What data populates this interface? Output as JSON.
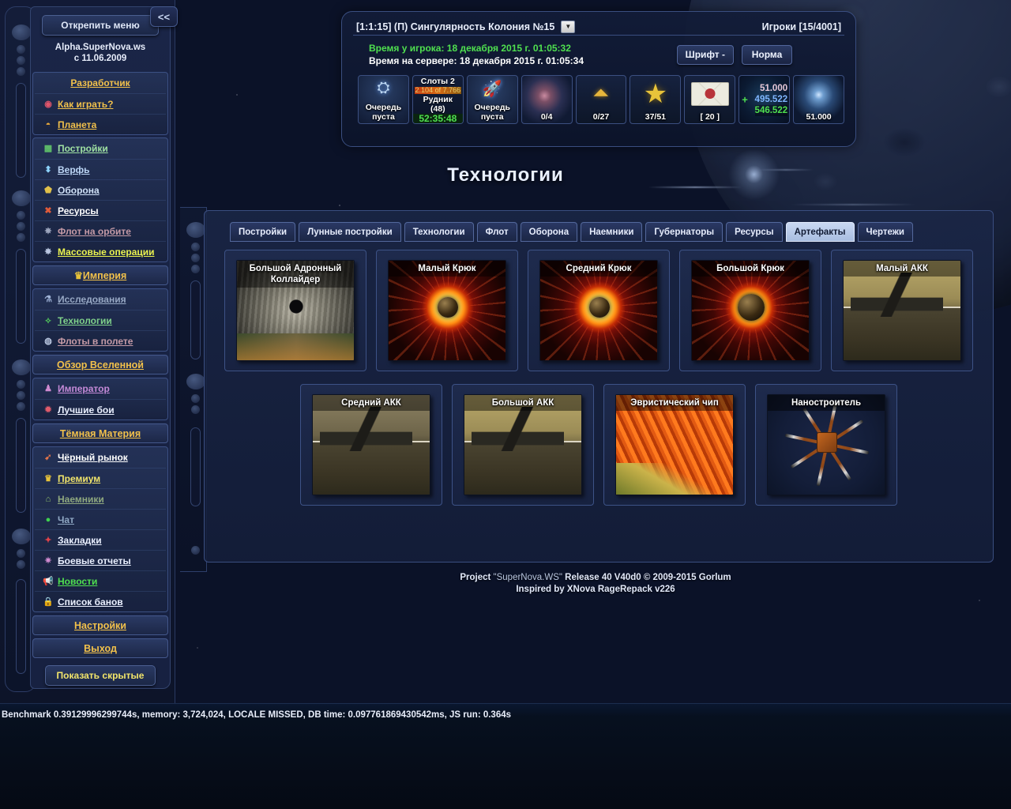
{
  "sidebar": {
    "collapse_label": "<<",
    "unpin_label": "Открепить меню",
    "site_line1": "Alpha.SuperNova.ws",
    "site_line2": "с 11.06.2009",
    "show_hidden_label": "Показать скрытые",
    "links": [
      {
        "label": "Разработчик",
        "icon": "",
        "color": "#f2c14b",
        "group": "a"
      },
      {
        "label": "Как играть?",
        "icon": "circle-red-icon",
        "glyph": "◉",
        "icon_color": "#e0556b",
        "color": "#f2c14b",
        "group": "a"
      },
      {
        "label": "Планета",
        "icon": "planet-icon",
        "glyph": "◓",
        "icon_color": "#e8a93c",
        "color": "#f2c14b",
        "group": "a"
      }
    ],
    "groups": [
      {
        "name": "buildings-group",
        "items": [
          {
            "label": "Постройки",
            "icon": "factory-icon",
            "glyph": "▩",
            "icon_color": "#5fc06a",
            "color": "#9fe0a2"
          },
          {
            "label": "Верфь",
            "icon": "shipyard-icon",
            "glyph": "⬍",
            "icon_color": "#8fd6ff",
            "color": "#bcd6f6"
          },
          {
            "label": "Оборона",
            "icon": "shield-icon",
            "glyph": "⬟",
            "icon_color": "#e0c04a",
            "color": "#cfe0f6"
          },
          {
            "label": "Ресурсы",
            "icon": "resources-icon",
            "glyph": "✖",
            "icon_color": "#e05b3a",
            "color": "#ffffff"
          },
          {
            "label": "Флот на орбите",
            "icon": "fleet-orbit-icon",
            "glyph": "✵",
            "icon_color": "#9fa8c0",
            "color": "#c49aa6"
          },
          {
            "label": "Массовые операции",
            "icon": "mass-ops-icon",
            "glyph": "✸",
            "icon_color": "#b9c6e0",
            "color": "#eaf24f"
          }
        ]
      }
    ],
    "empire_label": "Империя",
    "empire_icon": "crown-icon",
    "research_group": [
      {
        "label": "Исследования",
        "icon": "flask-icon",
        "glyph": "⚗",
        "icon_color": "#9fb3d6",
        "color": "#97a8c4"
      },
      {
        "label": "Технологии",
        "icon": "tech-icon",
        "glyph": "⟡",
        "icon_color": "#4fbf5a",
        "color": "#7fd18a"
      },
      {
        "label": "Флоты в полете",
        "icon": "fleets-flight-icon",
        "glyph": "◍",
        "icon_color": "#b9c6e0",
        "color": "#c49aa6"
      }
    ],
    "universe_label": "Обзор Вселенной",
    "emperor_group": [
      {
        "label": "Император",
        "icon": "emperor-icon",
        "glyph": "♟",
        "icon_color": "#d08ad0",
        "color": "#c58ad8"
      },
      {
        "label": "Лучшие бои",
        "icon": "best-battles-icon",
        "glyph": "✹",
        "icon_color": "#e05b6b",
        "color": "#eaf0ff"
      }
    ],
    "dark_matter_label": "Тёмная Материя",
    "market_group": [
      {
        "label": "Чёрный рынок",
        "icon": "market-icon",
        "glyph": "➹",
        "icon_color": "#e0734a",
        "color": "#ffffff"
      },
      {
        "label": "Премиум",
        "icon": "premium-crown-icon",
        "glyph": "♛",
        "icon_color": "#e8c33a",
        "color": "#f2e56b"
      },
      {
        "label": "Наемники",
        "icon": "mercenary-icon",
        "glyph": "⌂",
        "icon_color": "#8fbf6a",
        "color": "#8fa87f"
      },
      {
        "label": "Чат",
        "icon": "chat-icon",
        "glyph": "●",
        "icon_color": "#3fd14f",
        "color": "#8fa8c4"
      },
      {
        "label": "Закладки",
        "icon": "bookmark-icon",
        "glyph": "✦",
        "icon_color": "#e0434a",
        "color": "#eaf0ff"
      },
      {
        "label": "Боевые отчеты",
        "icon": "battle-reports-icon",
        "glyph": "✷",
        "icon_color": "#d08ad0",
        "color": "#eaf0ff"
      },
      {
        "label": "Новости",
        "icon": "news-icon",
        "glyph": "📢",
        "icon_color": "#e05b3a",
        "color": "#4fe04f"
      },
      {
        "label": "Список банов",
        "icon": "ban-list-icon",
        "glyph": "🔒",
        "icon_color": "#d6c46a",
        "color": "#eaf0ff"
      }
    ],
    "settings_label": "Настройки",
    "exit_label": "Выход"
  },
  "top_panel": {
    "planet_label": "[1:1:15] (П) Сингулярность Колония №15",
    "planet_caret": "▼",
    "players_label": "Игроки [15/4001]",
    "time_player": "Время у игрока: 18 декабря 2015 г. 01:05:32",
    "time_server": "Время на сервере: 18 декабря 2015 г. 01:05:34",
    "btn_font": "Шрифт -",
    "btn_norm": "Норма",
    "tiles": [
      {
        "name": "building-queue-tile",
        "type": "queue",
        "line1": "Очередь",
        "line2": "пуста"
      },
      {
        "name": "mine-slots-tile",
        "type": "slots",
        "title": "Слоты 2",
        "bar_text": "2.104 of 7.766",
        "name_line": "Рудник",
        "level": "(48)",
        "timer": "52:35:48"
      },
      {
        "name": "shipyard-queue-tile",
        "type": "queue2",
        "line1": "Очередь",
        "line2": "пуста"
      },
      {
        "name": "expedition-tile",
        "type": "nebula",
        "value": "0/4"
      },
      {
        "name": "fleet-tile",
        "type": "ship",
        "value": "0/27"
      },
      {
        "name": "officers-tile",
        "type": "star",
        "value": "37/51"
      },
      {
        "name": "messages-tile",
        "type": "mail",
        "value": "[ 20 ]"
      },
      {
        "name": "dark-matter-tile",
        "type": "dm",
        "plus": "+",
        "line1": "51.000",
        "line2": "495.522",
        "line3": "546.522"
      },
      {
        "name": "crystal-tile",
        "type": "crystal",
        "value": "51.000"
      }
    ]
  },
  "page": {
    "title": "Технологии"
  },
  "tabs": [
    {
      "label": "Постройки",
      "active": false
    },
    {
      "label": "Лунные постройки",
      "active": false
    },
    {
      "label": "Технологии",
      "active": false
    },
    {
      "label": "Флот",
      "active": false
    },
    {
      "label": "Оборона",
      "active": false
    },
    {
      "label": "Наемники",
      "active": false
    },
    {
      "label": "Губернаторы",
      "active": false
    },
    {
      "label": "Ресурсы",
      "active": false
    },
    {
      "label": "Артефакты",
      "active": true
    },
    {
      "label": "Чертежи",
      "active": false
    }
  ],
  "cards": {
    "row1": [
      {
        "title": "Большой Адронный Коллайдер",
        "art": "art-lhc"
      },
      {
        "title": "Малый Крюк",
        "art": "art-hook"
      },
      {
        "title": "Средний Крюк",
        "art": "art-hook"
      },
      {
        "title": "Большой Крюк",
        "art": "art-hook big"
      },
      {
        "title": "Малый АКК",
        "art": "art-akk"
      }
    ],
    "row2": [
      {
        "title": "Средний АКК",
        "art": "art-akk dark"
      },
      {
        "title": "Большой АКК",
        "art": "art-akk"
      },
      {
        "title": "Эвристический чип",
        "art": "art-chip"
      },
      {
        "title": "Наностроитель",
        "art": "art-nano"
      }
    ]
  },
  "footer": {
    "line1_a": "Project ",
    "line1_b": "\"SuperNova.WS\"",
    "line1_c": " Release 40 V40d0 © 2009-2015 Gorlum",
    "line2": "Inspired by XNova RageRepack v226"
  },
  "benchmark": {
    "text": "Benchmark 0.39129996299744s, memory: 3,724,024, LOCALE MISSED, DB time: 0.097761869430542ms, JS run: 0.364s"
  },
  "colors": {
    "accent_gold": "#f2c14b",
    "accent_green": "#4fe04f",
    "panel_bg": "#1a2647",
    "border": "#3a4e80"
  }
}
